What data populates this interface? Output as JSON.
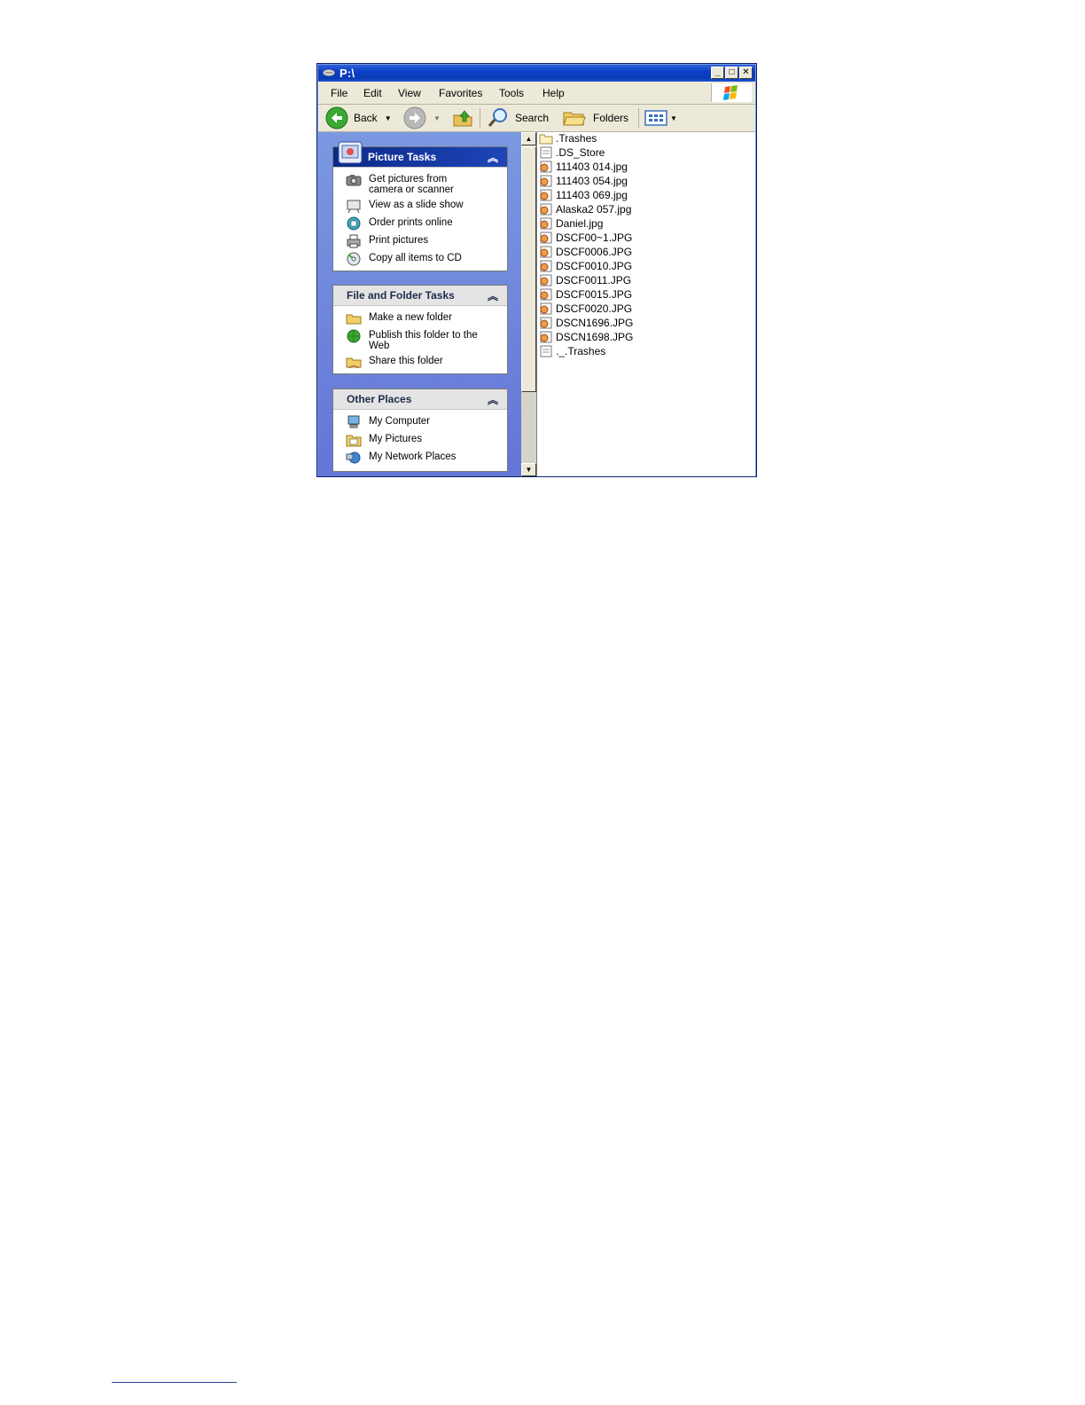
{
  "window": {
    "title": "P:\\"
  },
  "menu": [
    "File",
    "Edit",
    "View",
    "Favorites",
    "Tools",
    "Help"
  ],
  "toolbar": {
    "back_label": "Back",
    "search_label": "Search",
    "folders_label": "Folders"
  },
  "panels": {
    "picture_tasks": {
      "title": "Picture Tasks",
      "items": [
        "Get pictures from\ncamera or scanner",
        "View as a slide show",
        "Order prints online",
        "Print pictures",
        "Copy all items to CD"
      ]
    },
    "file_folder_tasks": {
      "title": "File and Folder Tasks",
      "items": [
        "Make a new folder",
        "Publish this folder to the\nWeb",
        "Share this folder"
      ]
    },
    "other_places": {
      "title": "Other Places",
      "items": [
        "My Computer",
        "My Pictures",
        "My Network Places"
      ]
    }
  },
  "files": [
    ".Trashes",
    ".DS_Store",
    "111403 014.jpg",
    "111403 054.jpg",
    "111403 069.jpg",
    "Alaska2 057.jpg",
    "Daniel.jpg",
    "DSCF00~1.JPG",
    "DSCF0006.JPG",
    "DSCF0010.JPG",
    "DSCF0011.JPG",
    "DSCF0015.JPG",
    "DSCF0020.JPG",
    "DSCN1696.JPG",
    "DSCN1698.JPG",
    "._.Trashes"
  ],
  "colors": {
    "titlebar": "#0a3ec7",
    "task_pane": "#6f86dc"
  }
}
